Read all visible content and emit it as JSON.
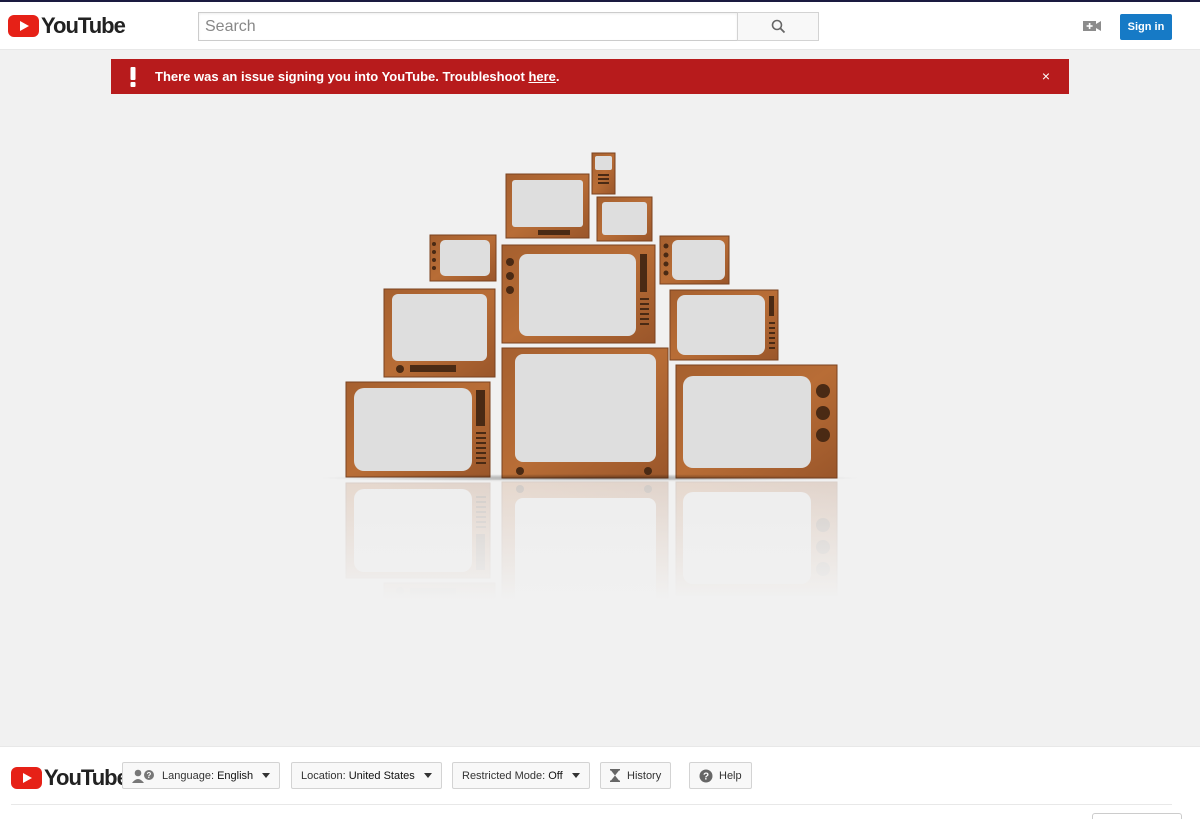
{
  "masthead": {
    "logo_text": "YouTube",
    "search_placeholder": "Search",
    "search_button_icon": "search-icon",
    "upload_icon": "video-camera-plus-icon",
    "signin_label": "Sign in",
    "accent_color": "#167ac6"
  },
  "alert": {
    "message": "There was an issue signing you into YouTube. Troubleshoot ",
    "link_text": "here",
    "suffix": ".",
    "close_label": "×",
    "color": "#b71b1c"
  },
  "footer": {
    "logo_text": "YouTube",
    "language_label": "Language:",
    "language_value": "English",
    "location_label": "Location:",
    "location_value": "United States",
    "restricted_label": "Restricted Mode:",
    "restricted_value": "Off",
    "history_label": "History",
    "help_label": "Help"
  }
}
